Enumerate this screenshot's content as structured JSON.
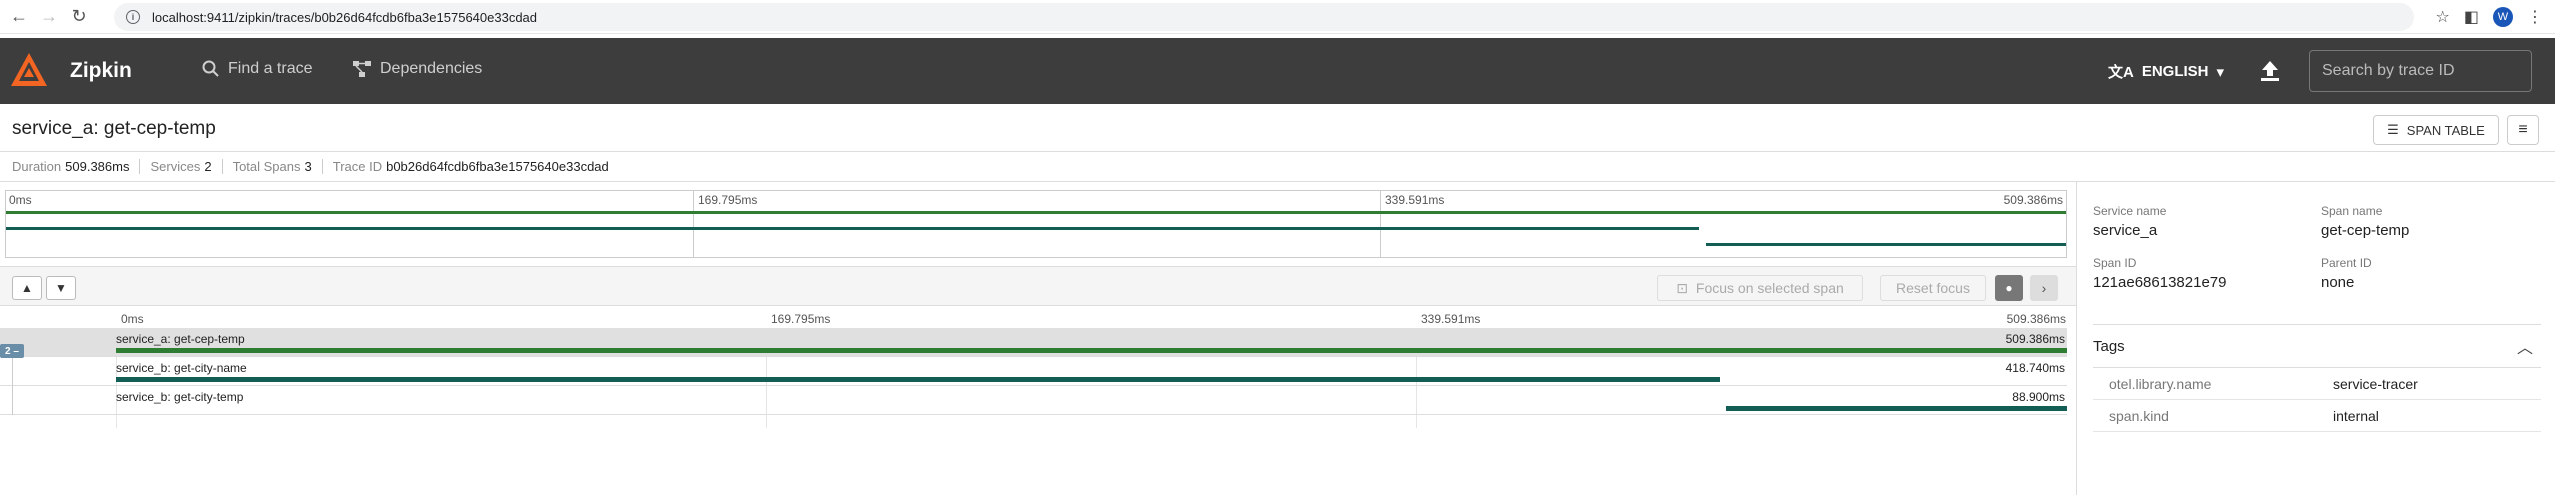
{
  "browser": {
    "url": "localhost:9411/zipkin/traces/b0b26d64fcdb6fba3e1575640e33cdad",
    "profile_initial": "W"
  },
  "header": {
    "brand": "Zipkin",
    "find_trace": "Find a trace",
    "dependencies": "Dependencies",
    "language": "ENGLISH",
    "search_placeholder": "Search by trace ID"
  },
  "trace": {
    "title": "service_a: get-cep-temp",
    "span_table_label": "SPAN TABLE"
  },
  "summary": {
    "duration_label": "Duration",
    "duration_value": "509.386ms",
    "services_label": "Services",
    "services_value": "2",
    "total_spans_label": "Total Spans",
    "total_spans_value": "3",
    "trace_id_label": "Trace ID",
    "trace_id_value": "b0b26d64fcdb6fba3e1575640e33cdad"
  },
  "timeline": {
    "ticks": [
      "0ms",
      "169.795ms",
      "339.591ms",
      "509.386ms"
    ],
    "focus_label": "Focus on selected span",
    "reset_label": "Reset focus",
    "expander_label": "2 –",
    "spans": [
      {
        "name": "service_a: get-cep-temp",
        "duration": "509.386ms",
        "start": 0.0,
        "end": 1.0,
        "root": true
      },
      {
        "name": "service_b: get-city-name",
        "duration": "418.740ms",
        "start": 0.0,
        "end": 0.822,
        "root": false
      },
      {
        "name": "service_b: get-city-temp",
        "duration": "88.900ms",
        "start": 0.825,
        "end": 1.0,
        "root": false
      }
    ]
  },
  "detail": {
    "service_name_label": "Service name",
    "service_name": "service_a",
    "span_name_label": "Span name",
    "span_name": "get-cep-temp",
    "span_id_label": "Span ID",
    "span_id": "121ae68613821e79",
    "parent_id_label": "Parent ID",
    "parent_id": "none",
    "tags_title": "Tags",
    "tags": [
      {
        "key": "otel.library.name",
        "value": "service-tracer"
      },
      {
        "key": "span.kind",
        "value": "internal"
      }
    ]
  },
  "colors": {
    "header_bg": "#3d3d3d",
    "span_bar": "#125e54",
    "root_bar": "#2e7d32",
    "logo": "#f26522"
  }
}
